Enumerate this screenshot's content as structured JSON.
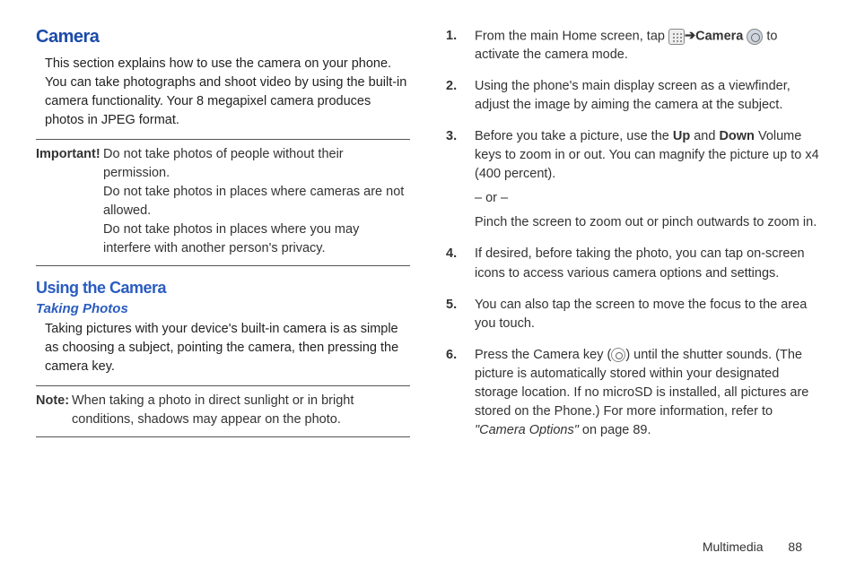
{
  "left": {
    "heading1": "Camera",
    "intro": "This section explains how to use the camera on your phone. You can take photographs and shoot video by using the built-in camera functionality. Your 8 megapixel camera produces photos in JPEG format.",
    "important_label": "Important!",
    "important_lines": [
      "Do not take photos of people without their permission.",
      "Do not take photos in places where cameras are not allowed.",
      "Do not take photos in places where you may interfere with another person's privacy."
    ],
    "heading2": "Using the Camera",
    "heading3": "Taking Photos",
    "taking_intro": "Taking pictures with your device's built-in camera is as simple as choosing a subject, pointing the camera, then pressing the camera key.",
    "note_label": "Note:",
    "note_text": "When taking a photo in direct sunlight or in bright conditions, shadows may appear on the photo."
  },
  "right": {
    "step1_a": "From the main Home screen, tap ",
    "step1_arrow": " ➔ ",
    "step1_camera_label": "Camera",
    "step1_b": " to activate the camera mode.",
    "step2": "Using the phone's main display screen as a viewfinder, adjust the image by aiming the camera at the subject.",
    "step3_a": "Before you take a picture, use the ",
    "step3_up": "Up",
    "step3_mid": " and ",
    "step3_down": "Down",
    "step3_b": " Volume keys to zoom in or out. You can magnify the picture up to x4 (400 percent).",
    "step3_or": "– or –",
    "step3_pinch": "Pinch the screen to zoom out or pinch outwards to zoom in.",
    "step4": "If desired, before taking the photo, you can tap on-screen icons to access various camera options and settings.",
    "step5": "You can also tap the screen to move the focus to the area you touch.",
    "step6_a": "Press the Camera key (",
    "step6_b": ") until the shutter sounds. (The picture is automatically stored within your designated storage location. If no microSD is installed, all pictures are stored on the Phone.) For more information, refer to ",
    "step6_ref": "\"Camera Options\"",
    "step6_c": "  on page 89."
  },
  "footer": {
    "section": "Multimedia",
    "page": "88"
  }
}
